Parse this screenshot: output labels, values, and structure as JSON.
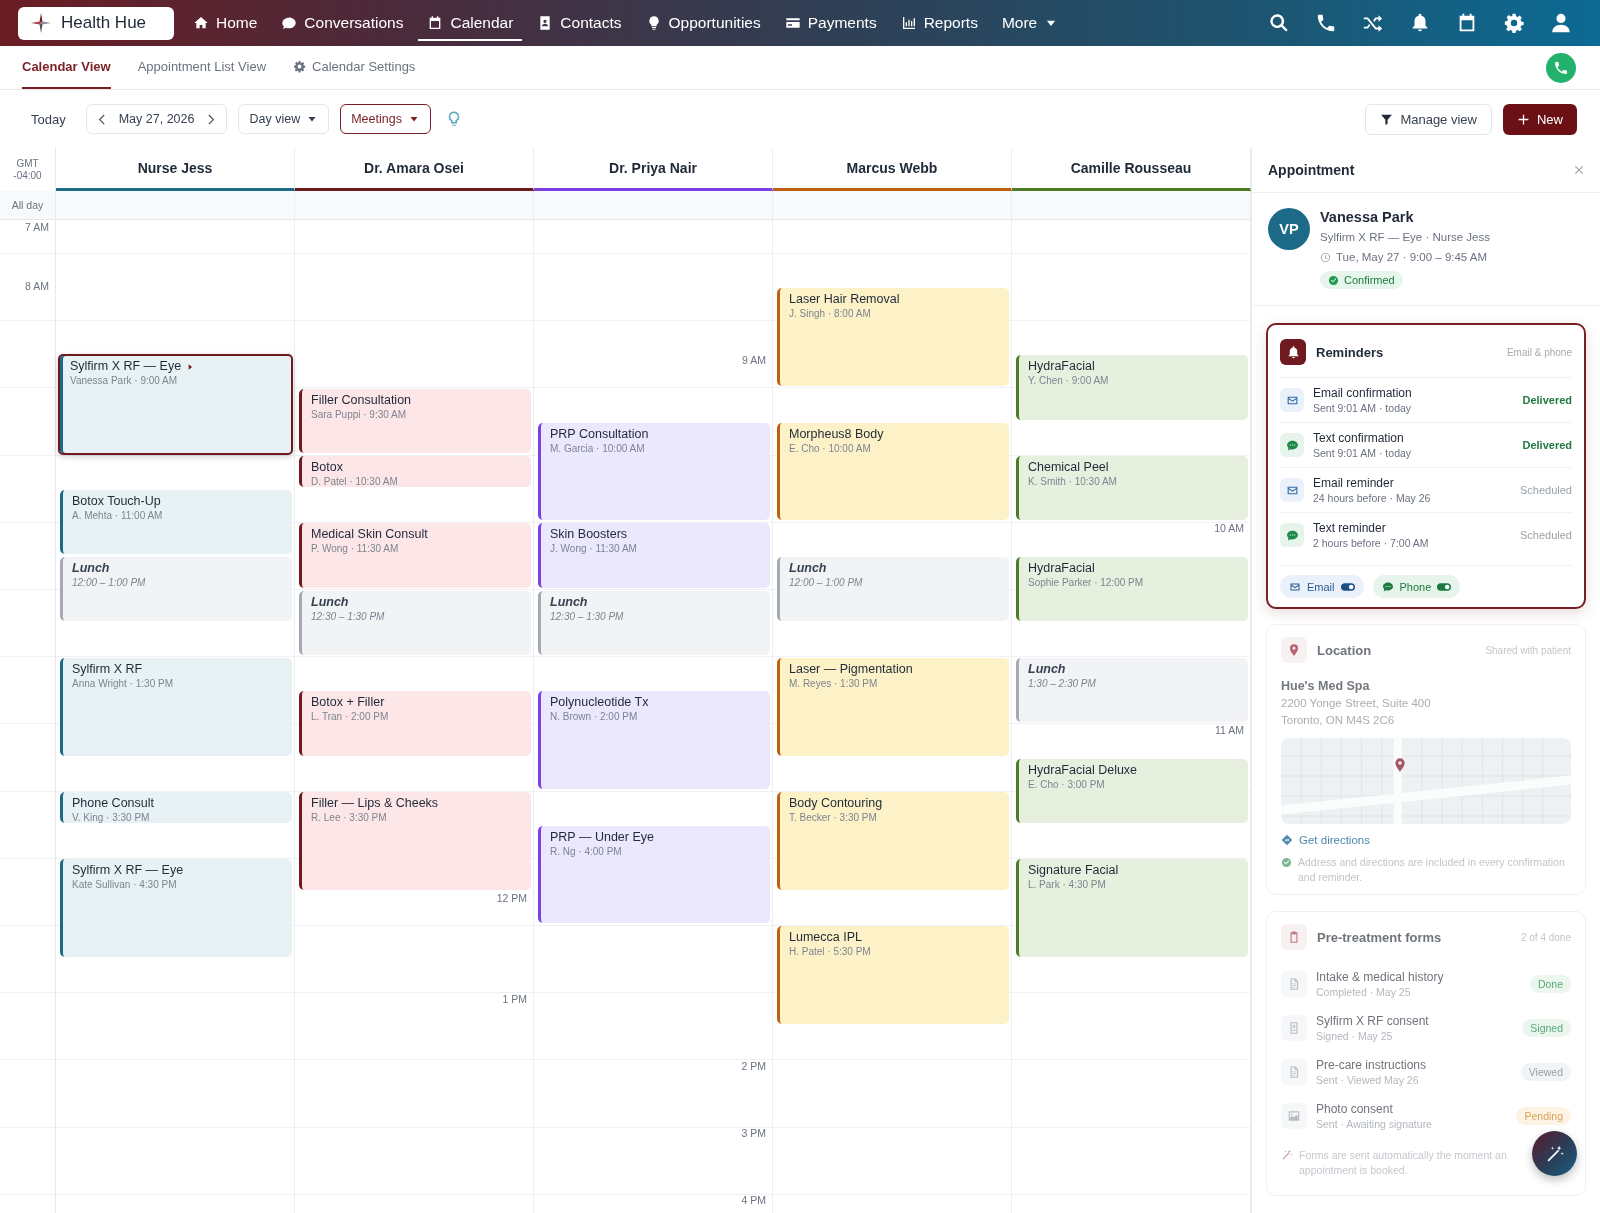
{
  "nav": {
    "logo": "Health Hue",
    "items": [
      {
        "label": "Home",
        "selected": false
      },
      {
        "label": "Conversations",
        "selected": false
      },
      {
        "label": "Calendar",
        "selected": true
      },
      {
        "label": "Contacts",
        "selected": false
      },
      {
        "label": "Opportunities",
        "selected": false
      },
      {
        "label": "Payments",
        "selected": false
      },
      {
        "label": "Reports",
        "selected": false
      }
    ],
    "more": "More"
  },
  "subnav": {
    "tabs": [
      {
        "label": "Calendar View",
        "selected": true
      },
      {
        "label": "Appointment List View",
        "selected": false
      }
    ],
    "settings": "Calendar Settings"
  },
  "toolbar": {
    "today": "Today",
    "date": "May 27, 2026",
    "view": "Day view",
    "filter": "Meetings",
    "manage": "Manage view",
    "new": "New"
  },
  "calendar": {
    "timezone": "GMT -04:00",
    "all_day": "All day",
    "time_labels": [
      "7 AM",
      "8 AM",
      "9 AM",
      "10 AM",
      "11 AM",
      "12 PM",
      "1 PM",
      "2 PM",
      "3 PM",
      "4 PM"
    ],
    "columns": [
      {
        "name": "Nurse Jess",
        "color": "#1b6a86",
        "events": [
          {
            "kind": "appointment",
            "title": "Sylfirm X RF — Eye",
            "detail": "Vanessa Park · 9:00 AM",
            "selected": true
          },
          {
            "kind": "appointment",
            "title": "Botox Touch-Up",
            "detail": "A. Mehta · 11:00 AM",
            "selected": false
          },
          {
            "kind": "break",
            "title": "Lunch",
            "detail": "12:00 – 1:00 PM",
            "selected": false
          },
          {
            "kind": "appointment",
            "title": "Sylfirm X RF",
            "detail": "Anna Wright · 1:30 PM",
            "selected": false
          },
          {
            "kind": "appointment",
            "title": "Phone Consult",
            "detail": "V. King · 3:30 PM",
            "selected": false
          },
          {
            "kind": "appointment",
            "title": "Sylfirm X RF — Eye",
            "detail": "Kate Sullivan · 4:30 PM",
            "selected": false
          }
        ]
      },
      {
        "name": "Dr. Amara Osei",
        "color": "#6e1a1f",
        "events": [
          {
            "kind": "appointment",
            "title": "Filler Consultation",
            "detail": "Sara Puppi · 9:30 AM",
            "selected": false
          },
          {
            "kind": "appointment",
            "title": "Botox",
            "detail": "D. Patel · 10:30 AM",
            "selected": false
          },
          {
            "kind": "appointment",
            "title": "Medical Skin Consult",
            "detail": "P. Wong · 11:30 AM",
            "selected": false
          },
          {
            "kind": "break",
            "title": "Lunch",
            "detail": "12:30 – 1:30 PM",
            "selected": false
          },
          {
            "kind": "appointment",
            "title": "Botox + Filler",
            "detail": "L. Tran · 2:00 PM",
            "selected": false
          },
          {
            "kind": "appointment",
            "title": "Filler — Lips & Cheeks",
            "detail": "R. Lee · 3:30 PM",
            "selected": false
          }
        ]
      },
      {
        "name": "Dr. Priya Nair",
        "color": "#7b3fe4",
        "events": [
          {
            "kind": "appointment",
            "title": "PRP Consultation",
            "detail": "M. Garcia · 10:00 AM",
            "selected": false
          },
          {
            "kind": "appointment",
            "title": "Skin Boosters",
            "detail": "J. Wong · 11:30 AM",
            "selected": false
          },
          {
            "kind": "break",
            "title": "Lunch",
            "detail": "12:30 – 1:30 PM",
            "selected": false
          },
          {
            "kind": "appointment",
            "title": "Polynucleotide Tx",
            "detail": "N. Brown · 2:00 PM",
            "selected": false
          },
          {
            "kind": "appointment",
            "title": "PRP — Under Eye",
            "detail": "R. Ng · 4:00 PM",
            "selected": false
          }
        ]
      },
      {
        "name": "Marcus Webb",
        "color": "#c0600e",
        "events": [
          {
            "kind": "appointment",
            "title": "Laser Hair Removal",
            "detail": "J. Singh · 8:00 AM",
            "selected": false
          },
          {
            "kind": "appointment",
            "title": "Morpheus8 Body",
            "detail": "E. Cho · 10:00 AM",
            "selected": false
          },
          {
            "kind": "break",
            "title": "Lunch",
            "detail": "12:00 – 1:00 PM",
            "selected": false
          },
          {
            "kind": "appointment",
            "title": "Laser — Pigmentation",
            "detail": "M. Reyes · 1:30 PM",
            "selected": false
          },
          {
            "kind": "appointment",
            "title": "Body Contouring",
            "detail": "T. Becker · 3:30 PM",
            "selected": false
          },
          {
            "kind": "appointment",
            "title": "Lumecca IPL",
            "detail": "H. Patel · 5:30 PM",
            "selected": false
          }
        ]
      },
      {
        "name": "Camille Rousseau",
        "color": "#4a7d26",
        "events": [
          {
            "kind": "appointment",
            "title": "HydraFacial",
            "detail": "Y. Chen · 9:00 AM",
            "selected": false
          },
          {
            "kind": "appointment",
            "title": "Chemical Peel",
            "detail": "K. Smith · 10:30 AM",
            "selected": false
          },
          {
            "kind": "appointment",
            "title": "HydraFacial",
            "detail": "Sophie Parker · 12:00 PM",
            "selected": false
          },
          {
            "kind": "break",
            "title": "Lunch",
            "detail": "1:30 – 2:30 PM",
            "selected": false
          },
          {
            "kind": "appointment",
            "title": "HydraFacial Deluxe",
            "detail": "E. Cho · 3:00 PM",
            "selected": false
          },
          {
            "kind": "appointment",
            "title": "Signature Facial",
            "detail": "L. Park · 4:30 PM",
            "selected": false
          }
        ]
      }
    ]
  },
  "panel": {
    "title": "Appointment",
    "patient": {
      "initials": "VP",
      "name": "Vanessa Park",
      "service": "Sylfirm X RF — Eye · Nurse Jess",
      "time": "Tue, May 27 · 9:00 – 9:45 AM",
      "status": "Confirmed"
    },
    "reminders": {
      "title": "Reminders",
      "channels": "Email & phone",
      "items": [
        {
          "kind": "email",
          "title": "Email confirmation",
          "detail": "Sent 9:01 AM · today",
          "status": "Delivered",
          "delivered": true
        },
        {
          "kind": "text",
          "title": "Text confirmation",
          "detail": "Sent 9:01 AM · today",
          "status": "Delivered",
          "delivered": true
        },
        {
          "kind": "email",
          "title": "Email reminder",
          "detail": "24 hours before · May 26",
          "status": "Scheduled",
          "delivered": false
        },
        {
          "kind": "text",
          "title": "Text reminder",
          "detail": "2 hours before · 7:00 AM",
          "status": "Scheduled",
          "delivered": false
        }
      ],
      "toggles": [
        {
          "kind": "email",
          "label": "Email",
          "on": true
        },
        {
          "kind": "text",
          "label": "Phone",
          "on": true
        }
      ]
    },
    "location": {
      "title": "Location",
      "note": "Shared with patient",
      "name": "Hue's Med Spa",
      "address": [
        "2200 Yonge Street, Suite 400",
        "Toronto, ON M4S 2C6"
      ],
      "link": "Get directions",
      "info": "Address and directions are included in every confirmation and reminder."
    },
    "forms": {
      "title": "Pre-treatment forms",
      "progress": "2 of 4 done",
      "items": [
        {
          "kind": "complete",
          "title": "Intake & medical history",
          "detail": "Completed · May 25",
          "status": "Done"
        },
        {
          "kind": "complete",
          "title": "Sylfirm X RF consent",
          "detail": "Signed · May 25",
          "status": "Signed"
        },
        {
          "kind": "viewed",
          "title": "Pre-care instructions",
          "detail": "Sent · Viewed May 26",
          "status": "Viewed"
        },
        {
          "kind": "pending",
          "title": "Photo consent",
          "detail": "Sent · Awaiting signature",
          "status": "Pending"
        }
      ],
      "footer": "Forms are sent automatically the moment an appointment is booked."
    }
  }
}
